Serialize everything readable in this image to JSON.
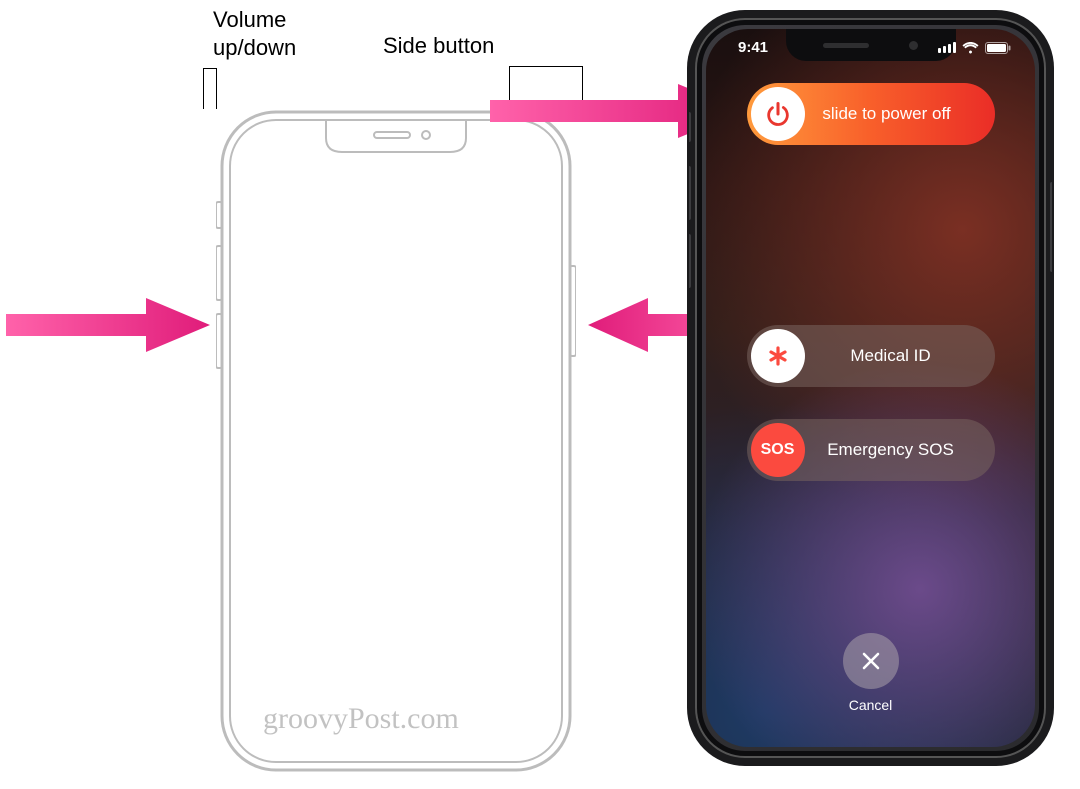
{
  "labels": {
    "volume": "Volume\nup/down",
    "side_button": "Side button"
  },
  "status": {
    "time": "9:41"
  },
  "sliders": {
    "power_off": "slide to power off",
    "medical_id": "Medical ID",
    "emergency_sos": "Emergency SOS",
    "sos_label": "SOS"
  },
  "cancel": {
    "label": "Cancel"
  },
  "watermark": "groovyPost.com",
  "colors": {
    "arrow_stroke": "#e61e8c",
    "arrow_fill_start": "#ff4fa0",
    "arrow_fill_end": "#e01c7a",
    "slider_gradient_a": "#ff9a3c",
    "slider_gradient_b": "#ea2d27",
    "sos_red": "#fb4a3f",
    "power_icon": "#e9372f"
  }
}
